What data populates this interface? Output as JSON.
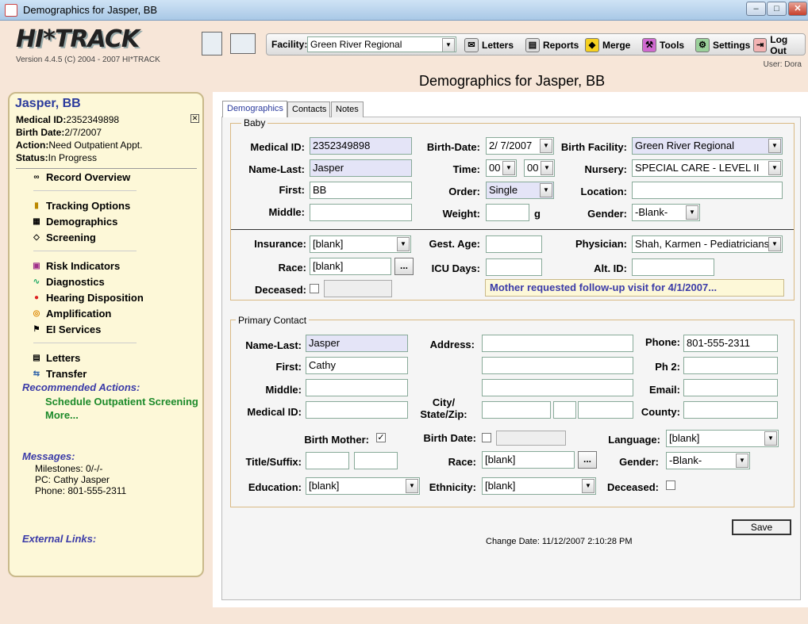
{
  "window": {
    "title": "Demographics for Jasper, BB"
  },
  "header": {
    "logo": "HI*TRACK",
    "version": "Version 4.4.5 (C) 2004 - 2007 HI*TRACK",
    "user": "User: Dora",
    "page_title": "Demographics for Jasper, BB"
  },
  "toolbar": {
    "facility_label": "Facility:",
    "facility_value": "Green River Regional",
    "letters": "Letters",
    "reports": "Reports",
    "merge": "Merge",
    "tools": "Tools",
    "settings": "Settings",
    "logout": "Log Out"
  },
  "sidebar": {
    "patient_name": "Jasper, BB",
    "medical_id_label": "Medical ID:",
    "medical_id": "2352349898",
    "birth_date_label": "Birth Date:",
    "birth_date": "2/7/2007",
    "action_label": "Action:",
    "action": "Need Outpatient Appt.",
    "status_label": "Status:",
    "status": "In Progress",
    "nav": [
      {
        "label": "Record Overview",
        "icon": "glasses-icon"
      },
      {
        "label": "Tracking Options",
        "icon": "traffic-light-icon"
      },
      {
        "label": "Demographics",
        "icon": "card-icon"
      },
      {
        "label": "Screening",
        "icon": "screening-icon"
      },
      {
        "label": "Risk Indicators",
        "icon": "risk-icon"
      },
      {
        "label": "Diagnostics",
        "icon": "diagnostics-icon"
      },
      {
        "label": "Hearing Disposition",
        "icon": "hearing-icon"
      },
      {
        "label": "Amplification",
        "icon": "amplification-icon"
      },
      {
        "label": "EI Services",
        "icon": "services-icon"
      },
      {
        "label": "Letters",
        "icon": "letters-icon"
      },
      {
        "label": "Transfer",
        "icon": "transfer-icon"
      }
    ],
    "recommended_label": "Recommended Actions:",
    "recommended_action": "Schedule Outpatient Screening",
    "more": "More...",
    "messages_label": "Messages:",
    "messages": [
      "Milestones: 0/-/-",
      "PC: Cathy Jasper",
      "Phone: 801-555-2311"
    ],
    "external_label": "External Links:"
  },
  "tabs": [
    "Demographics",
    "Contacts",
    "Notes"
  ],
  "baby": {
    "legend": "Baby",
    "medical_id_label": "Medical ID:",
    "medical_id": "2352349898",
    "name_last_label": "Name-Last:",
    "name_last": "Jasper",
    "first_label": "First:",
    "first": "BB",
    "middle_label": "Middle:",
    "middle": "",
    "birth_date_label": "Birth-Date:",
    "birth_date": "2/ 7/2007",
    "time_label": "Time:",
    "time_h": "00",
    "time_m": "00",
    "order_label": "Order:",
    "order": "Single",
    "weight_label": "Weight:",
    "weight": "",
    "weight_unit": "g",
    "birth_facility_label": "Birth Facility:",
    "birth_facility": "Green River Regional",
    "nursery_label": "Nursery:",
    "nursery": "SPECIAL CARE - LEVEL II",
    "location_label": "Location:",
    "location": "",
    "gender_label": "Gender:",
    "gender": "-Blank-",
    "insurance_label": "Insurance:",
    "insurance": "[blank]",
    "race_label": "Race:",
    "race": "[blank]",
    "deceased_label": "Deceased:",
    "gest_age_label": "Gest. Age:",
    "gest_age": "",
    "icu_label": "ICU Days:",
    "icu": "",
    "physician_label": "Physician:",
    "physician": "Shah, Karmen - Pediatricians",
    "alt_id_label": "Alt. ID:",
    "alt_id": "",
    "note": "Mother requested follow-up visit for 4/1/2007..."
  },
  "contact": {
    "legend": "Primary Contact",
    "name_last_label": "Name-Last:",
    "name_last": "Jasper",
    "first_label": "First:",
    "first": "Cathy",
    "middle_label": "Middle:",
    "middle": "",
    "medical_id_label": "Medical ID:",
    "medical_id": "",
    "address_label": "Address:",
    "city_label": "City/\nState/Zip:",
    "phone_label": "Phone:",
    "phone": "801-555-2311",
    "ph2_label": "Ph 2:",
    "ph2": "",
    "email_label": "Email:",
    "email": "",
    "county_label": "County:",
    "county": "",
    "birth_mother_label": "Birth Mother:",
    "birth_date_label": "Birth Date:",
    "language_label": "Language:",
    "language": "[blank]",
    "title_label": "Title/Suffix:",
    "race_label": "Race:",
    "race": "[blank]",
    "gender_label": "Gender:",
    "gender": "-Blank-",
    "education_label": "Education:",
    "education": "[blank]",
    "ethnicity_label": "Ethnicity:",
    "ethnicity": "[blank]",
    "deceased_label": "Deceased:"
  },
  "footer": {
    "save": "Save",
    "change_date": "Change Date: 11/12/2007 2:10:28 PM"
  }
}
